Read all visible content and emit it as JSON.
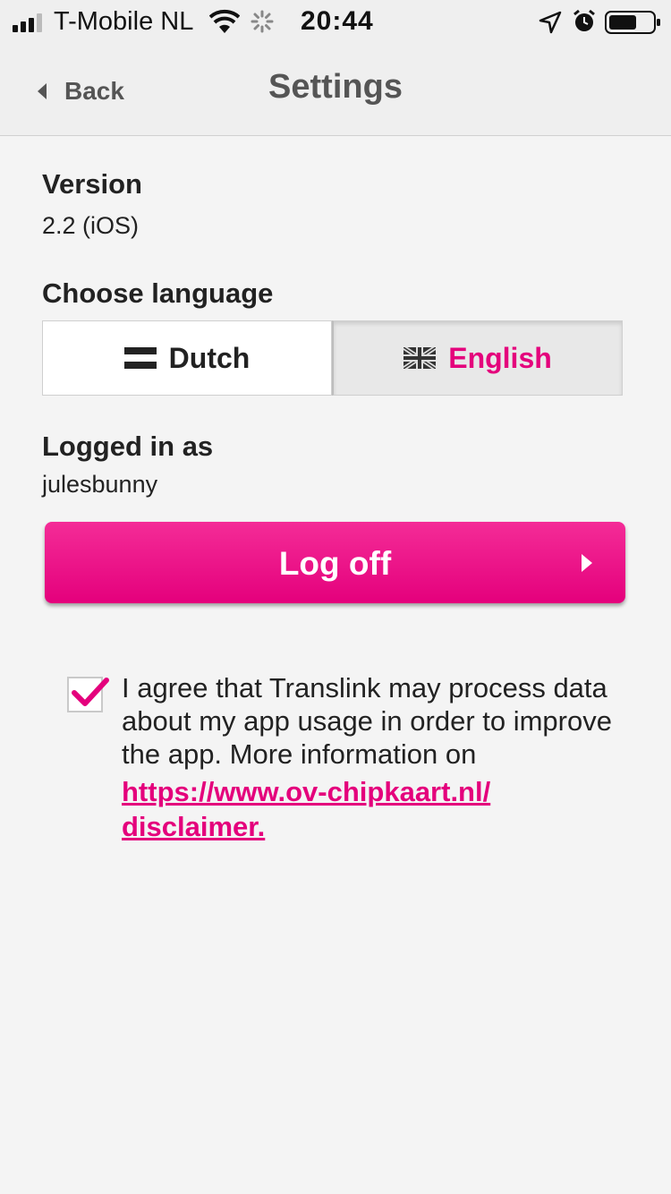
{
  "status_bar": {
    "carrier": "T-Mobile NL",
    "time": "20:44",
    "icons": [
      "signal-icon",
      "wifi-icon",
      "activity-spinner-icon",
      "location-arrow-icon",
      "alarm-clock-icon",
      "battery-icon"
    ]
  },
  "nav": {
    "back_label": "Back",
    "title": "Settings"
  },
  "version": {
    "heading": "Version",
    "value": "2.2 (iOS)"
  },
  "language": {
    "heading": "Choose language",
    "options": [
      {
        "label": "Dutch",
        "icon": "dutch-flag-icon",
        "selected": false
      },
      {
        "label": "English",
        "icon": "uk-flag-icon",
        "selected": true
      }
    ]
  },
  "account": {
    "heading": "Logged in as",
    "username": "julesbunny",
    "logoff_label": "Log off"
  },
  "consent": {
    "checked": true,
    "text": "I agree that Translink may process data about my app usage in order to improve the app. More information on",
    "link_text_1": "https://www.ov-chipkaart.nl/",
    "link_text_2": "disclaimer."
  },
  "colors": {
    "accent": "#e4007c",
    "background": "#f4f4f4",
    "navbar": "#efefef"
  }
}
